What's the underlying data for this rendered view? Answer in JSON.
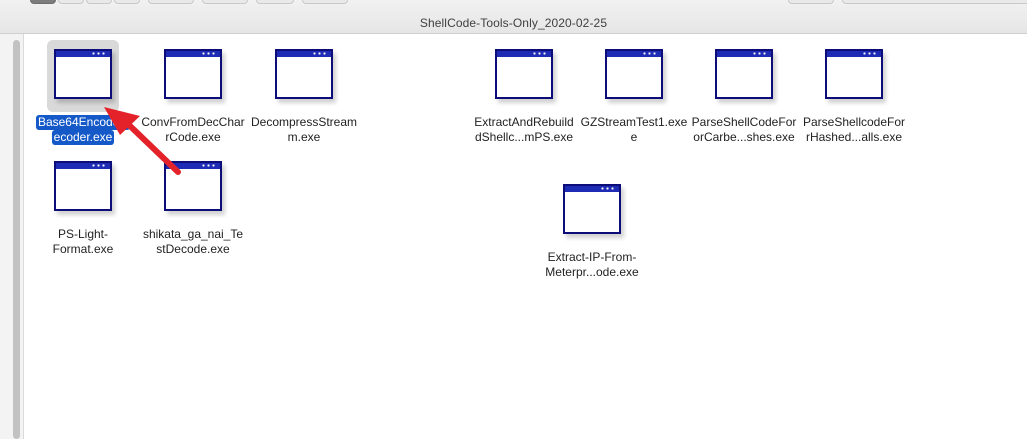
{
  "window": {
    "title": "ShellCode-Tools-Only_2020-02-25"
  },
  "colors": {
    "selection": "#1559c9",
    "icon_frame": "#0d0d7a",
    "icon_bar": "#1d2bb5",
    "annotation_arrow": "#e3222a"
  },
  "files": [
    {
      "line1": "Base64EncodeD",
      "line2": "ecoder.exe",
      "selected": true,
      "icon": "exe-window-icon"
    },
    {
      "line1": "ConvFromDecChar",
      "line2": "rCode.exe",
      "icon": "exe-window-icon"
    },
    {
      "line1": "DecompressStream",
      "line2": "m.exe",
      "icon": "exe-window-icon"
    },
    {
      "line1": "ExtractAndRebuild",
      "line2": "dShellc...mPS.exe",
      "icon": "exe-window-icon"
    },
    {
      "line1": "GZStreamTest1.exe",
      "line2": "e",
      "icon": "exe-window-icon"
    },
    {
      "line1": "ParseShellCodeFor",
      "line2": "orCarbe...shes.exe",
      "icon": "exe-window-icon"
    },
    {
      "line1": "ParseShellcodeFor",
      "line2": "rHashed...alls.exe",
      "icon": "exe-window-icon"
    },
    {
      "line1": "PS-Light-",
      "line2": "Format.exe",
      "icon": "exe-window-icon"
    },
    {
      "line1": "shikata_ga_nai_Te",
      "line2": "stDecode.exe",
      "icon": "exe-window-icon"
    },
    {
      "line1": "Extract-IP-From-",
      "line2": "Meterpr...ode.exe",
      "icon": "exe-window-icon"
    }
  ]
}
